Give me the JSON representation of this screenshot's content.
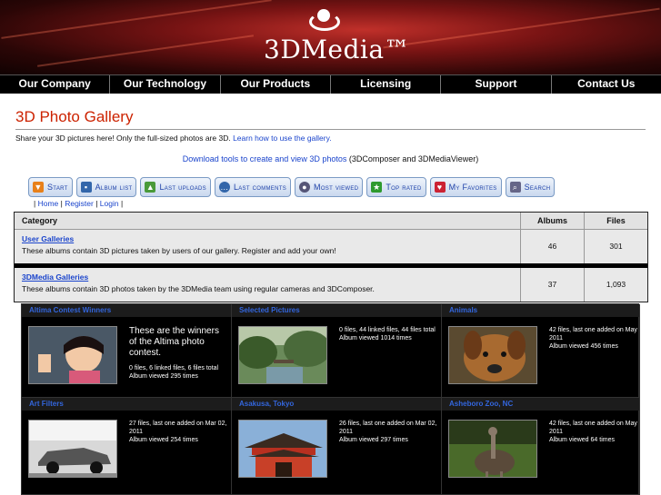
{
  "header": {
    "logo_text": "3DMedia™"
  },
  "nav": {
    "items": [
      {
        "label": "Our Company"
      },
      {
        "label": "Our Technology"
      },
      {
        "label": "Our Products"
      },
      {
        "label": "Licensing"
      },
      {
        "label": "Support"
      },
      {
        "label": "Contact Us"
      }
    ]
  },
  "main": {
    "title": "3D Photo Gallery",
    "intro_text": "Share your 3D pictures here! Only the full-sized photos are 3D. ",
    "intro_link": "Learn how to use the gallery.",
    "download_link": "Download tools to create and view 3D photos",
    "download_suffix": " (3DComposer and 3DMediaViewer)"
  },
  "toolbar": {
    "buttons": [
      {
        "label": "Start",
        "icon": "arrow-down-icon",
        "color": "#e8801a"
      },
      {
        "label": "Album list",
        "icon": "album-list-icon",
        "color": "#3366aa"
      },
      {
        "label": "Last uploads",
        "icon": "upload-icon",
        "color": "#4a9a3a"
      },
      {
        "label": "Last comments",
        "icon": "comment-icon",
        "color": "#3366aa"
      },
      {
        "label": "Most viewed",
        "icon": "eye-icon",
        "color": "#555577"
      },
      {
        "label": "Top rated",
        "icon": "star-icon",
        "color": "#2e9a2e"
      },
      {
        "label": "My Favorites",
        "icon": "heart-icon",
        "color": "#cc2233"
      },
      {
        "label": "Search",
        "icon": "search-icon",
        "color": "#666688"
      }
    ]
  },
  "user_links": {
    "home": "Home",
    "register": "Register",
    "login": "Login"
  },
  "categories": {
    "headers": {
      "category": "Category",
      "albums": "Albums",
      "files": "Files"
    },
    "rows": [
      {
        "name": "User Galleries",
        "description": "These albums contain 3D pictures taken by users of our gallery. Register and add your own!",
        "albums": "46",
        "files": "301"
      },
      {
        "name": "3DMedia Galleries",
        "description": "These albums contain 3D photos taken by the 3DMedia team using regular cameras and 3DComposer.",
        "albums": "37",
        "files": "1,093"
      }
    ]
  },
  "albums": [
    {
      "title": "Altima Contest Winners",
      "description": "These are the winners of the Altima photo contest.",
      "stats": "0 files, 6 linked files, 6 files total",
      "views": "Album viewed 295 times"
    },
    {
      "title": "Selected Pictures",
      "description": "",
      "stats": "0 files, 44 linked files, 44 files total",
      "views": "Album viewed 1014 times"
    },
    {
      "title": "Animals",
      "description": "",
      "stats": "42 files, last one added on May 02, 2011",
      "views": "Album viewed 456 times"
    },
    {
      "title": "Art Filters",
      "description": "",
      "stats": "27 files, last one added on Mar 02, 2011",
      "views": "Album viewed 254 times"
    },
    {
      "title": "Asakusa, Tokyo",
      "description": "",
      "stats": "26 files, last one added on Mar 02, 2011",
      "views": "Album viewed 297 times"
    },
    {
      "title": "Asheboro Zoo, NC",
      "description": "",
      "stats": "42 files, last one added on May 02, 2011",
      "views": "Album viewed 64 times"
    }
  ]
}
